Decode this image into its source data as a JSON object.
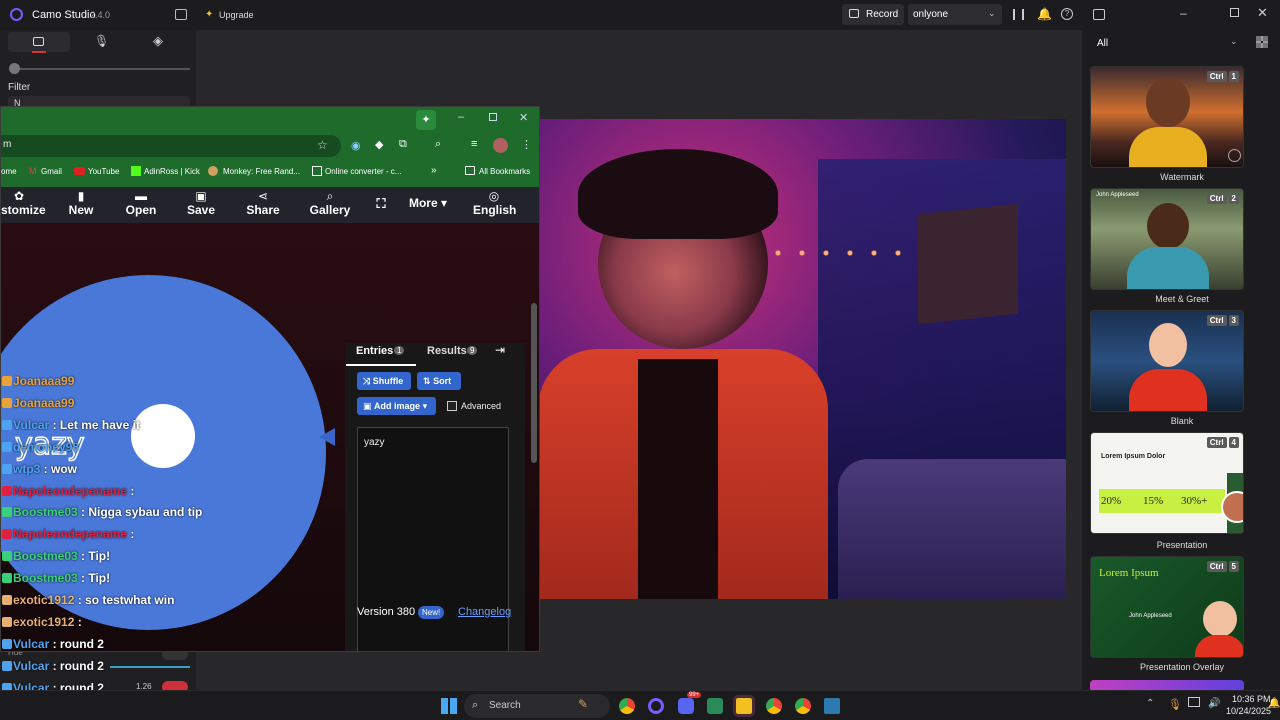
{
  "app": {
    "name": "Camo Studio",
    "version": "2.4.0",
    "upgrade": "Upgrade",
    "record": "Record",
    "scene_select": "onlyone"
  },
  "left_panel": {
    "filter_label": "Filter",
    "filter_value": "N",
    "hue_label": "Hue",
    "value_label": "1.26"
  },
  "right_panel": {
    "filter": "All",
    "scenes": [
      {
        "label": "Watermark",
        "key": "Ctrl",
        "num": "1"
      },
      {
        "label": "Meet & Greet",
        "key": "Ctrl",
        "num": "2",
        "name_tag": "John Appleseed"
      },
      {
        "label": "Blank",
        "key": "Ctrl",
        "num": "3"
      },
      {
        "label": "Presentation",
        "key": "Ctrl",
        "num": "4",
        "title": "Lorem Ipsum Dolor",
        "stats": [
          "20%",
          "15%",
          "30%+"
        ]
      },
      {
        "label": "Presentation Overlay",
        "key": "Ctrl",
        "num": "5",
        "title": "Lorem Ipsum",
        "name_tag": "John Appleseed"
      }
    ]
  },
  "browser": {
    "address": "m",
    "bookmarks": [
      "ome",
      "Gmail",
      "YouTube",
      "AdinRoss | Kick",
      "Monkey: Free Rand...",
      "Online converter - c...",
      "All Bookmarks"
    ],
    "nav": [
      {
        "label": "stomize",
        "icon": "palette-icon"
      },
      {
        "label": "New",
        "icon": "file-icon"
      },
      {
        "label": "Open",
        "icon": "folder-icon"
      },
      {
        "label": "Save",
        "icon": "save-icon"
      },
      {
        "label": "Share",
        "icon": "share-icon"
      },
      {
        "label": "Gallery",
        "icon": "search-icon"
      },
      {
        "label": "",
        "icon": "fullscreen-icon"
      },
      {
        "label": "More",
        "icon": "chevron-down-icon"
      },
      {
        "label": "English",
        "icon": "globe-icon"
      }
    ],
    "tabs": {
      "entries_label": "Entries",
      "entries_count": "1",
      "results_label": "Results",
      "results_count": "9"
    },
    "buttons": {
      "shuffle": "Shuffle",
      "sort": "Sort",
      "add_image": "Add image",
      "advanced": "Advanced"
    },
    "entries_text": "yazy",
    "version": "Version 380",
    "new_badge": "New!",
    "changelog": "Changelog",
    "wheel_text": "yazy"
  },
  "chat": [
    {
      "user": "Joanaaa99",
      "msg": "",
      "color": "#e8a23a"
    },
    {
      "user": "Joanaaa99",
      "msg": "",
      "color": "#e8a23a"
    },
    {
      "user": "Vulcar",
      "msg": " : Let me have it",
      "color": "#4ea3f0"
    },
    {
      "user": "demoney98",
      "msg": "",
      "color": "#4ea3f0"
    },
    {
      "user": "wtp3",
      "msg": " : wow",
      "color": "#4ea3f0"
    },
    {
      "user": "Napoleondepename",
      "msg": " : ",
      "color": "#e02040"
    },
    {
      "user": "Boostme03",
      "msg": " : Nigga sybau and tip",
      "color": "#3ad07a"
    },
    {
      "user": "Napoleondepename",
      "msg": " : ",
      "color": "#e02040"
    },
    {
      "user": "Boostme03",
      "msg": " : Tip!",
      "color": "#3ad07a"
    },
    {
      "user": "Boostme03",
      "msg": " : Tip!",
      "color": "#3ad07a"
    },
    {
      "user": "exotic1912",
      "msg": " : so testwhat win",
      "color": "#e8b070"
    },
    {
      "user": "exotic1912",
      "msg": " : ",
      "color": "#e8b070"
    },
    {
      "user": "Vulcar",
      "msg": " : round 2",
      "color": "#4ea3f0"
    },
    {
      "user": "Vulcar",
      "msg": " : round 2",
      "color": "#4ea3f0"
    },
    {
      "user": "Vulcar",
      "msg": " : round 2",
      "color": "#4ea3f0"
    }
  ],
  "taskbar": {
    "search": "Search",
    "time": "10:36 PM",
    "date": "10/24/2025",
    "discord_badge": "99+"
  },
  "colors": {
    "accent": "#7a5cff",
    "browser_green": "#1e6b2c",
    "blue": "#3366cc"
  }
}
